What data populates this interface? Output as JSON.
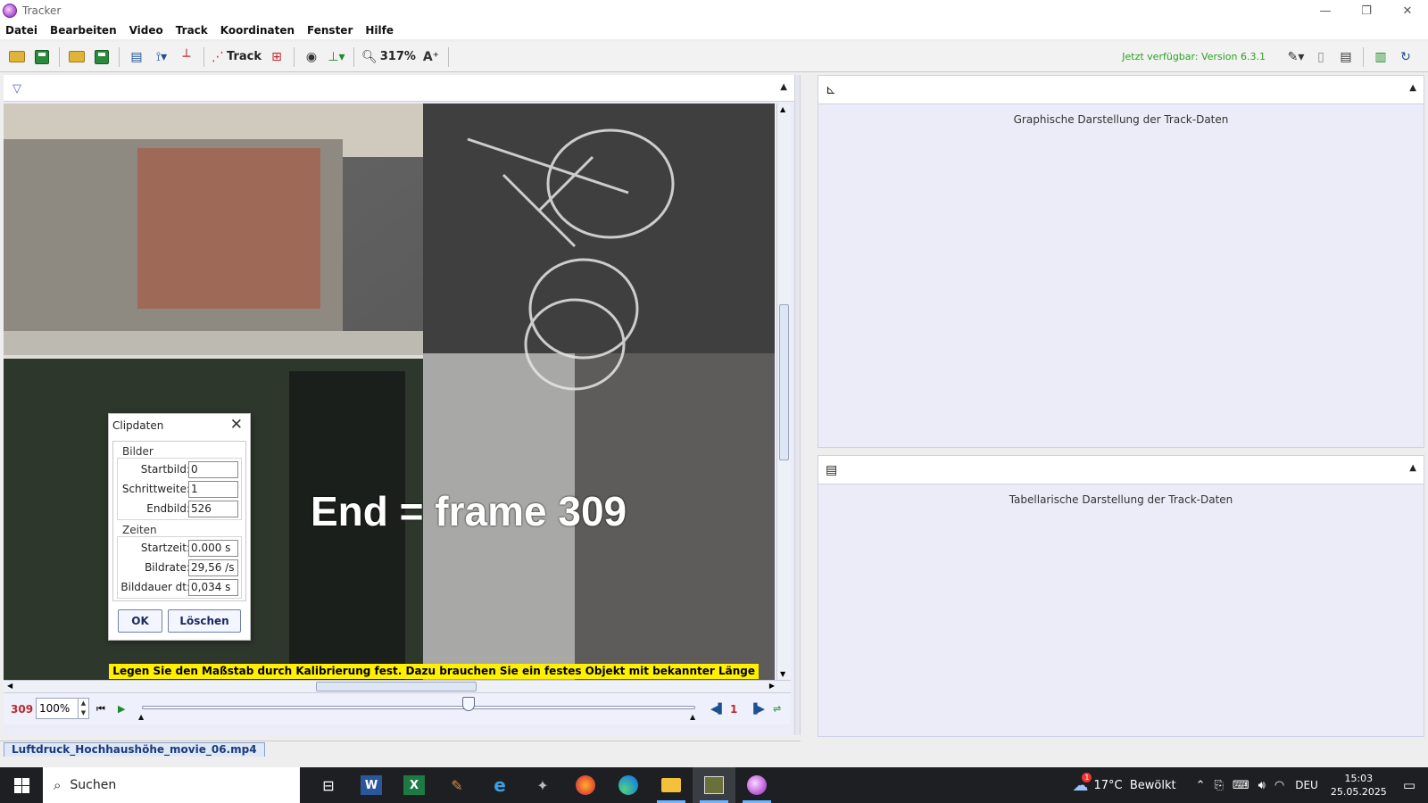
{
  "window": {
    "title": "Tracker"
  },
  "menu": [
    "Datei",
    "Bearbeiten",
    "Video",
    "Track",
    "Koordinaten",
    "Fenster",
    "Hilfe"
  ],
  "toolbar": {
    "track_label": "Track",
    "zoom_label": "317%",
    "update_text": "Jetzt verfügbar: Version 6.3.1"
  },
  "video": {
    "overlay_text": "End = frame 309",
    "calibration_hint": "Legen Sie den Maßstab durch Kalibrierung fest. Dazu brauchen Sie ein festes Objekt mit bekannter Länge",
    "current_frame": "309",
    "zoom_value": "100%",
    "step_size": "1",
    "file_tab": "Luftdruck_Hochhaushöhe_movie_06.mp4"
  },
  "plot_panel": {
    "placeholder": "Graphische Darstellung der Track-Daten"
  },
  "table_panel": {
    "placeholder": "Tabellarische Darstellung der Track-Daten"
  },
  "dialog": {
    "title": "Clipdaten",
    "group_frames": "Bilder",
    "group_times": "Zeiten",
    "fields": [
      {
        "label": "Startbild:",
        "value": "0"
      },
      {
        "label": "Schrittweite:",
        "value": "1"
      },
      {
        "label": "Endbild:",
        "value": "526"
      },
      {
        "label": "Startzeit:",
        "value": "0.000 s"
      },
      {
        "label": "Bildrate:",
        "value": "29,56 /s"
      },
      {
        "label": "Bilddauer dt:",
        "value": "0,034 s"
      }
    ],
    "ok_label": "OK",
    "delete_label": "Löschen"
  },
  "taskbar": {
    "search_label": "Suchen",
    "weather": "17°C  Bewölkt",
    "weather_badge": "1",
    "lang": "DEU",
    "time": "15:03",
    "date": "25.05.2025"
  },
  "colors": {
    "accent_red": "#c1272d",
    "update_green": "#2aa320",
    "banner_yellow": "#ffef00",
    "panel_bg": "#ececf8"
  }
}
